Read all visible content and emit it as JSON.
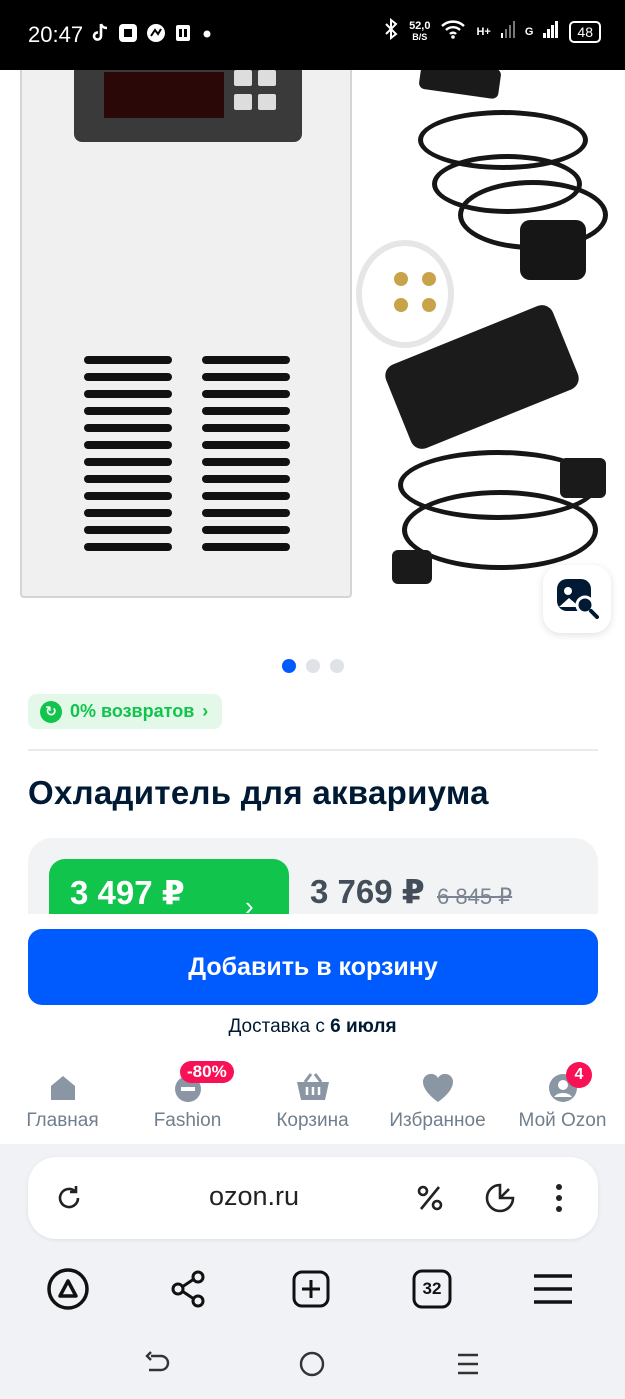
{
  "status_bar": {
    "time": "20:47",
    "net_speed_value": "52,0",
    "net_speed_unit": "B/S",
    "signal_1": "H+",
    "signal_2": "G",
    "battery": "48"
  },
  "product": {
    "image_pages": 3,
    "active_image": 1,
    "returns_label": "0% возвратов",
    "title": "Охладитель для аквариума",
    "card_price": "3 497 ₽",
    "price": "3 769 ₽",
    "old_price": "6 845 ₽",
    "add_to_cart_label": "Добавить в корзину",
    "delivery_prefix": "Доставка с ",
    "delivery_date": "6 июля"
  },
  "bottom_nav": {
    "items": [
      {
        "label": "Главная",
        "icon": "home-icon"
      },
      {
        "label": "Fashion",
        "icon": "fashion-icon",
        "badge": "-80%"
      },
      {
        "label": "Корзина",
        "icon": "cart-icon"
      },
      {
        "label": "Избранное",
        "icon": "heart-icon"
      },
      {
        "label": "Мой Ozon",
        "icon": "profile-icon",
        "badge": "4"
      }
    ]
  },
  "browser": {
    "url": "ozon.ru",
    "tabs_count": "32"
  },
  "colors": {
    "accent_blue": "#005bff",
    "green": "#10c44c",
    "pink": "#f91155"
  }
}
